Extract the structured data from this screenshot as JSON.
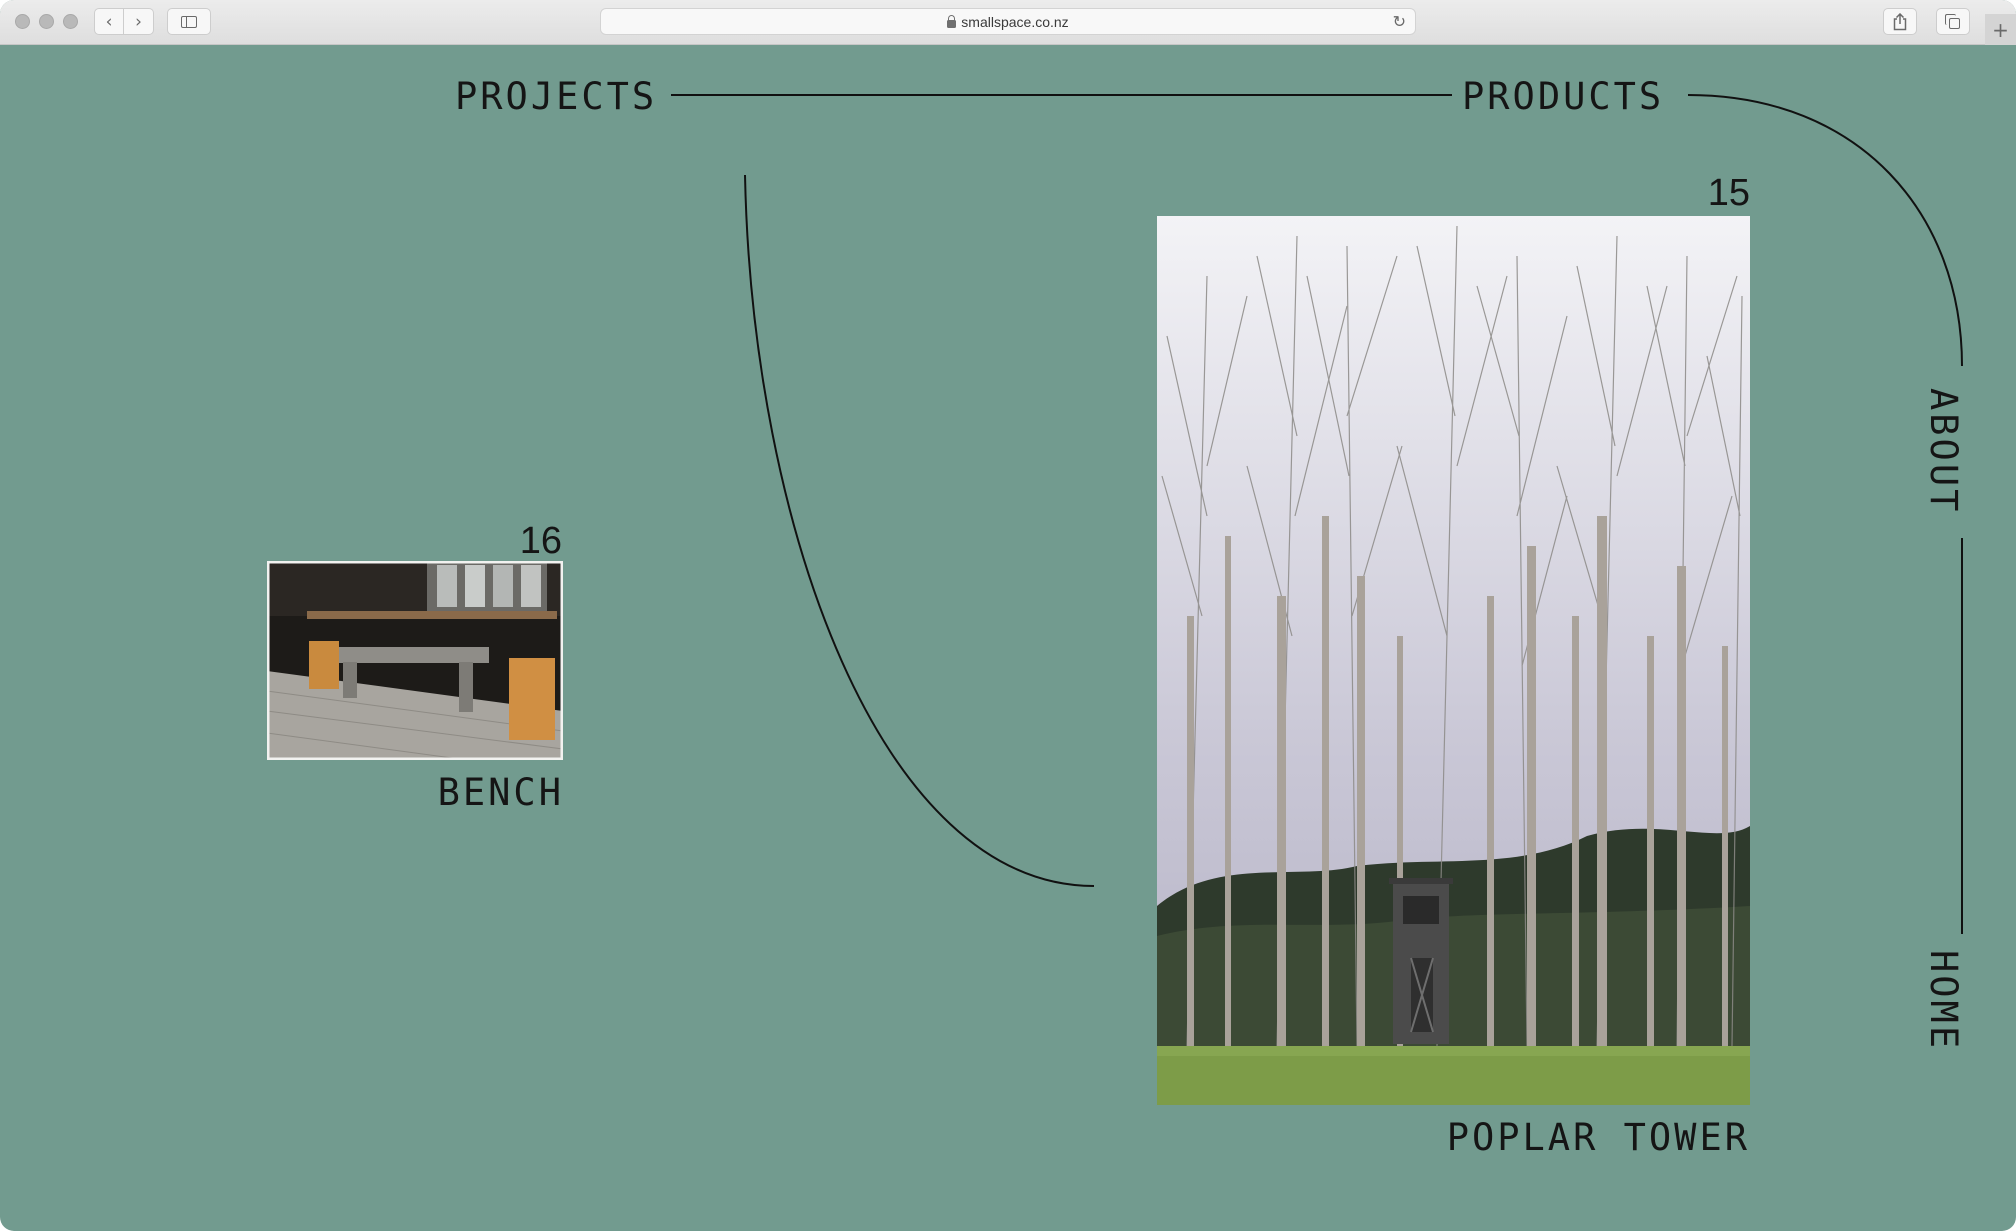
{
  "browser": {
    "url": "smallspace.co.nz",
    "icons": {
      "back": "chevron-left-icon",
      "forward": "chevron-right-icon",
      "sidebar": "sidebar-icon",
      "lock": "lock-icon",
      "reload": "reload-icon",
      "share": "share-icon",
      "tabs": "tabs-icon",
      "new_tab": "plus-icon"
    }
  },
  "nav": {
    "projects": "PROJECTS",
    "products": "PRODUCTS",
    "about": "ABOUT",
    "home": "HOME"
  },
  "items": [
    {
      "number": "16",
      "title": "BENCH"
    },
    {
      "number": "15",
      "title": "POPLAR TOWER"
    }
  ],
  "colors": {
    "background": "#729b8f",
    "text": "#151515",
    "line": "#111111"
  }
}
